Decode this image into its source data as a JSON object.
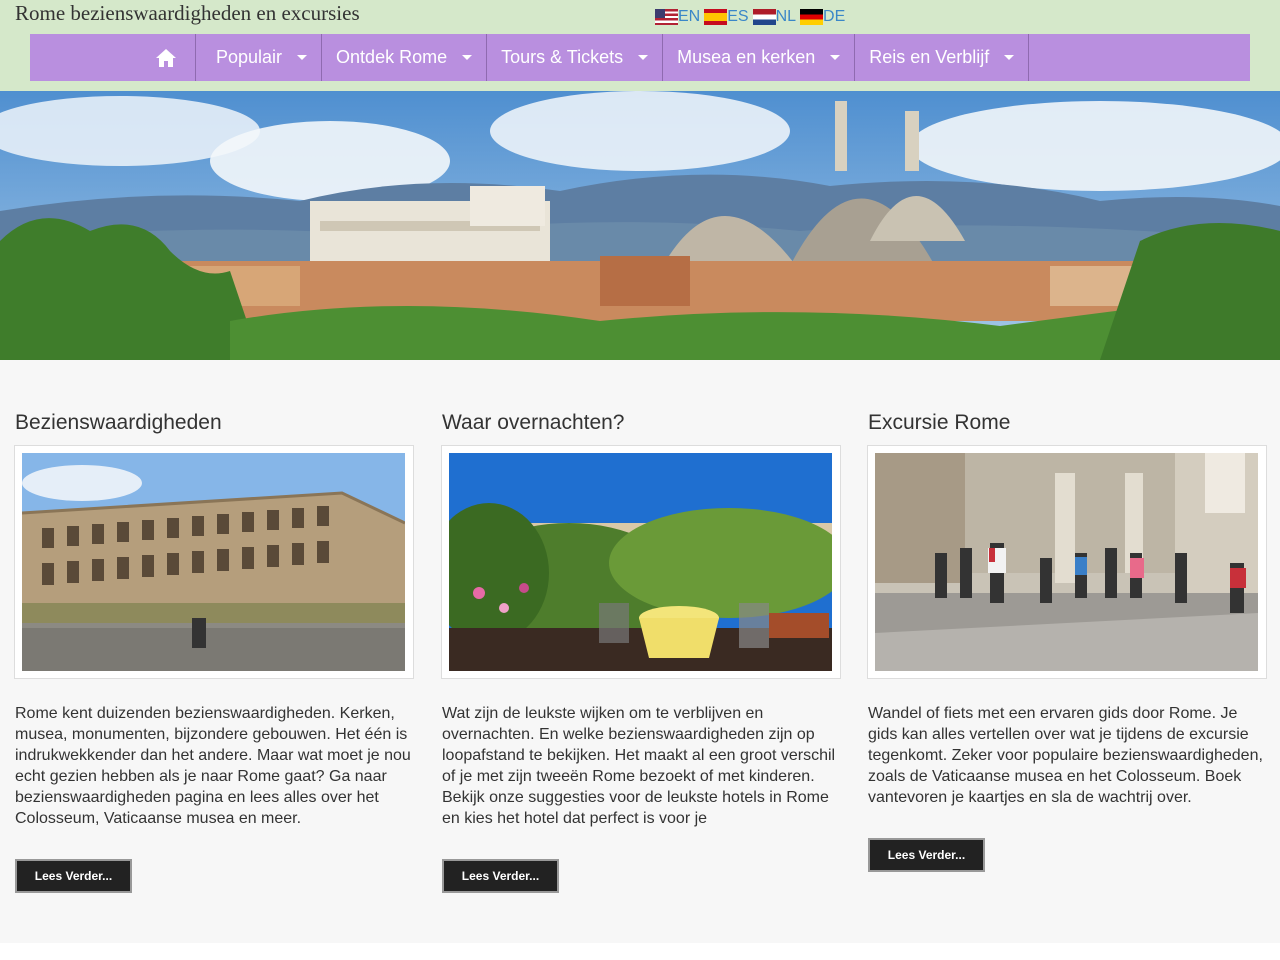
{
  "site": {
    "title": "Rome bezienswaardigheden en excursies"
  },
  "languages": [
    {
      "code": "EN",
      "flag": "us-flag-icon"
    },
    {
      "code": "ES",
      "flag": "spain-flag-icon"
    },
    {
      "code": "NL",
      "flag": "netherlands-flag-icon"
    },
    {
      "code": "DE",
      "flag": "germany-flag-icon"
    }
  ],
  "nav": {
    "home_icon": "home-icon",
    "items": [
      {
        "label": "Populair"
      },
      {
        "label": "Ontdek Rome"
      },
      {
        "label": "Tours & Tickets"
      },
      {
        "label": "Musea en kerken"
      },
      {
        "label": "Reis en Verblijf"
      }
    ]
  },
  "hero": {
    "image": "rome-skyline-panorama"
  },
  "cards": [
    {
      "title": "Bezienswaardigheden",
      "image": "colosseum-photo",
      "text": "Rome kent duizenden bezienswaardigheden. Kerken, musea, monumenten, bijzondere gebouwen. Het één is indrukwekkender dan het andere. Maar wat moet je nou echt gezien hebben als je naar Rome gaat? Ga naar bezienswaardigheden pagina en lees alles over het Colosseum, Vaticaanse musea en meer.",
      "button": "Lees Verder..."
    },
    {
      "title": "Waar overnachten?",
      "image": "hotel-terrace-photo",
      "text": "Wat zijn de leukste wijken om te verblijven en overnachten. En welke bezienswaardigheden zijn op loopafstand te bekijken. Het maakt al een groot verschil of je met zijn tweeën Rome bezoekt of met kinderen. Bekijk onze suggesties voor de leukste hotels in Rome en kies het hotel dat perfect is voor je",
      "button": "Lees Verder..."
    },
    {
      "title": "Excursie Rome",
      "image": "segway-tour-photo",
      "text": "Wandel of fiets met een ervaren gids door Rome. Je gids kan alles vertellen over wat je tijdens de excursie tegenkomt. Zeker voor populaire bezienswaardigheden, zoals de Vaticaanse musea en het Colosseum. Boek vantevoren je kaartjes en sla de wachtrij over.",
      "button": "Lees Verder..."
    }
  ],
  "colors": {
    "header_bg": "#d5e8ca",
    "nav_bg": "#b98fdf",
    "link": "#3a87c8",
    "button_bg": "#222222",
    "content_bg": "#f7f7f7"
  }
}
